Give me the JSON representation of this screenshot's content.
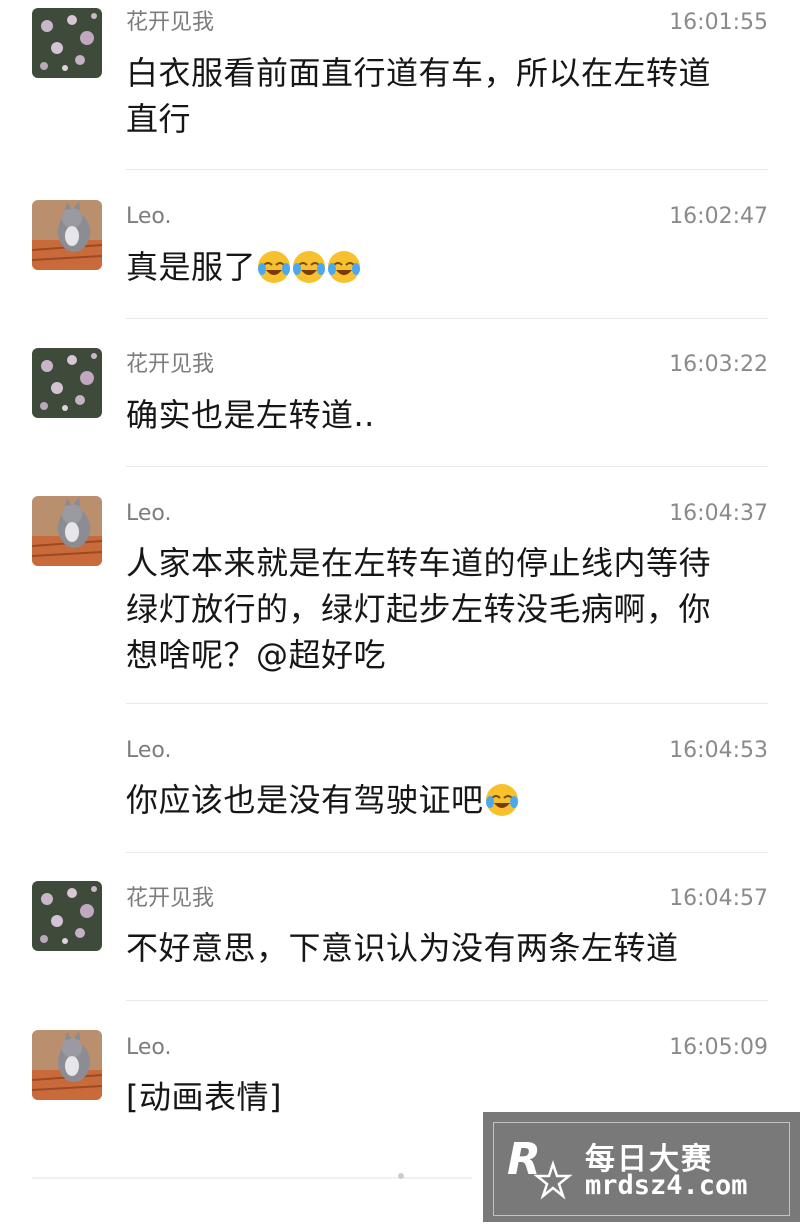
{
  "comments": [
    {
      "name": "花开见我",
      "time": "16:01:55",
      "lines": [
        "白衣服看前面直行道有车，所以在左转道",
        "直行"
      ],
      "emoji": 0,
      "avatar": "flower"
    },
    {
      "name": "Leo.",
      "time": "16:02:47",
      "lines": [
        "真是服了"
      ],
      "emoji": 3,
      "avatar": "cat"
    },
    {
      "name": "花开见我",
      "time": "16:03:22",
      "lines": [
        "确实也是左转道.."
      ],
      "emoji": 0,
      "avatar": "flower"
    },
    {
      "name": "Leo.",
      "time": "16:04:37",
      "lines": [
        "人家本来就是在左转车道的停止线内等待",
        "绿灯放行的，绿灯起步左转没毛病啊，你",
        "想啥呢？@超好吃"
      ],
      "emoji": 0,
      "avatar": "cat"
    },
    {
      "name": "Leo.",
      "time": "16:04:53",
      "lines": [
        "你应该也是没有驾驶证吧"
      ],
      "emoji": 1,
      "avatar": "none"
    },
    {
      "name": "花开见我",
      "time": "16:04:57",
      "lines": [
        "不好意思，下意识认为没有两条左转道"
      ],
      "emoji": 0,
      "avatar": "flower"
    },
    {
      "name": "Leo.",
      "time": "16:05:09",
      "lines": [
        "[动画表情]"
      ],
      "emoji": 0,
      "avatar": "cat"
    }
  ],
  "watermark": {
    "title": "每日大赛",
    "url": "mrdsz4.com",
    "logo_letter": "R"
  },
  "emoji_name": "laugh-cry-emoji-icon"
}
